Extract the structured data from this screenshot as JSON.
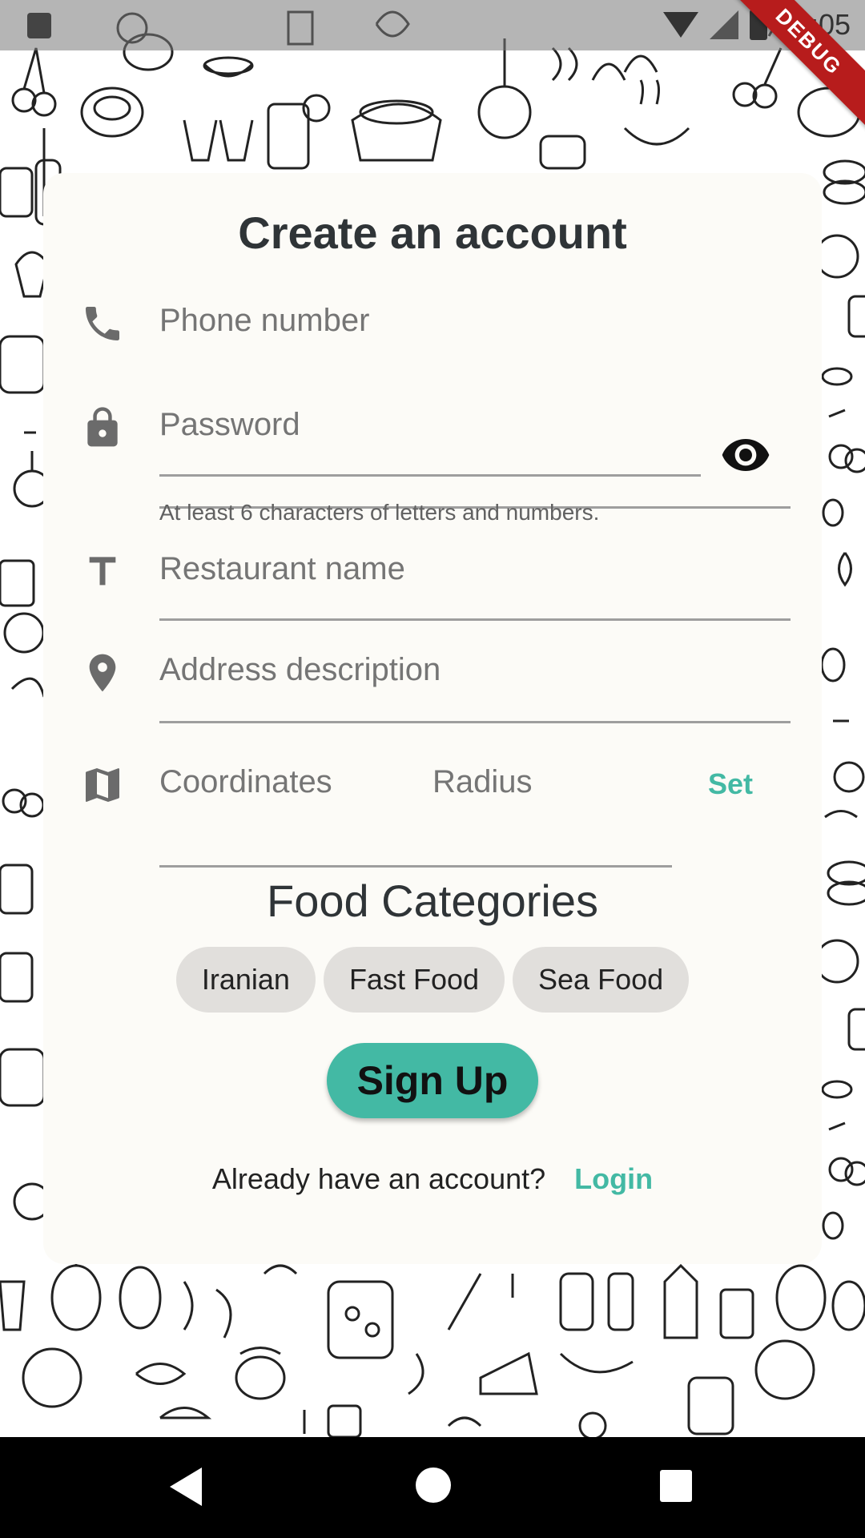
{
  "status": {
    "time": "10:05"
  },
  "debug_banner": "DEBUG",
  "form": {
    "title": "Create an account",
    "phone": {
      "placeholder": "Phone number",
      "icon": "phone-icon"
    },
    "password": {
      "placeholder": "Password",
      "hint": "At least 6 characters of letters and numbers.",
      "icon": "lock-icon",
      "toggle_icon": "eye-icon"
    },
    "restaurant": {
      "placeholder": "Restaurant name",
      "icon": "text-icon"
    },
    "address": {
      "placeholder": "Address description",
      "icon": "location-pin-icon"
    },
    "location": {
      "coordinates_placeholder": "Coordinates",
      "radius_placeholder": "Radius",
      "set_label": "Set",
      "icon": "map-icon"
    }
  },
  "categories": {
    "title": "Food Categories",
    "items": [
      "Iranian",
      "Fast Food",
      "Sea Food"
    ]
  },
  "signup_label": "Sign Up",
  "footer": {
    "question": "Already have an account?",
    "login_label": "Login"
  },
  "colors": {
    "accent": "#43b9a4",
    "card": "#fcfbf7",
    "chip": "#e1dfdc",
    "debug": "#b71c1c"
  }
}
